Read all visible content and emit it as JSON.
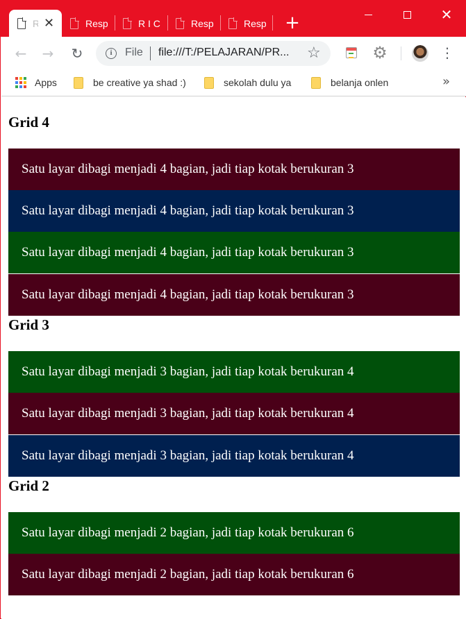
{
  "browser": {
    "tabs": [
      {
        "label": "R",
        "active": true
      },
      {
        "label": "Resp",
        "active": false
      },
      {
        "label": "R I C",
        "active": false
      },
      {
        "label": "Resp",
        "active": false
      },
      {
        "label": "Resp",
        "active": false
      }
    ],
    "new_tab_icon": "plus-icon",
    "window_controls": [
      "minimize-icon",
      "maximize-icon",
      "close-icon"
    ],
    "accent_color": "#e81123"
  },
  "toolbar": {
    "scheme_label": "File",
    "url": "file:///T:/PELAJARAN/PR..."
  },
  "bookmarks": {
    "apps_label": "Apps",
    "items": [
      {
        "label": "be creative ya shad :)"
      },
      {
        "label": "sekolah dulu ya"
      },
      {
        "label": "belanja onlen"
      }
    ],
    "more_label": "»"
  },
  "page": {
    "sections": [
      {
        "heading": "Grid 4",
        "boxes": [
          {
            "text": "Satu layar dibagi menjadi 4 bagian, jadi tiap kotak berukuran 3",
            "color": "#4a0018"
          },
          {
            "text": "Satu layar dibagi menjadi 4 bagian, jadi tiap kotak berukuran 3",
            "color": "#00204f"
          },
          {
            "text": "Satu layar dibagi menjadi 4 bagian, jadi tiap kotak berukuran 3",
            "color": "#00500a"
          },
          {
            "text": "Satu layar dibagi menjadi 4 bagian, jadi tiap kotak berukuran 3",
            "color": "#4a0018"
          }
        ]
      },
      {
        "heading": "Grid 3",
        "boxes": [
          {
            "text": "Satu layar dibagi menjadi 3 bagian, jadi tiap kotak berukuran 4",
            "color": "#00500a"
          },
          {
            "text": "Satu layar dibagi menjadi 3 bagian, jadi tiap kotak berukuran 4",
            "color": "#4a0018"
          },
          {
            "text": "Satu layar dibagi menjadi 3 bagian, jadi tiap kotak berukuran 4",
            "color": "#00204f"
          }
        ]
      },
      {
        "heading": "Grid 2",
        "boxes": [
          {
            "text": "Satu layar dibagi menjadi 2 bagian, jadi tiap kotak berukuran 6",
            "color": "#00500a"
          },
          {
            "text": "Satu layar dibagi menjadi 2 bagian, jadi tiap kotak berukuran 6",
            "color": "#4a0018"
          }
        ]
      }
    ]
  }
}
